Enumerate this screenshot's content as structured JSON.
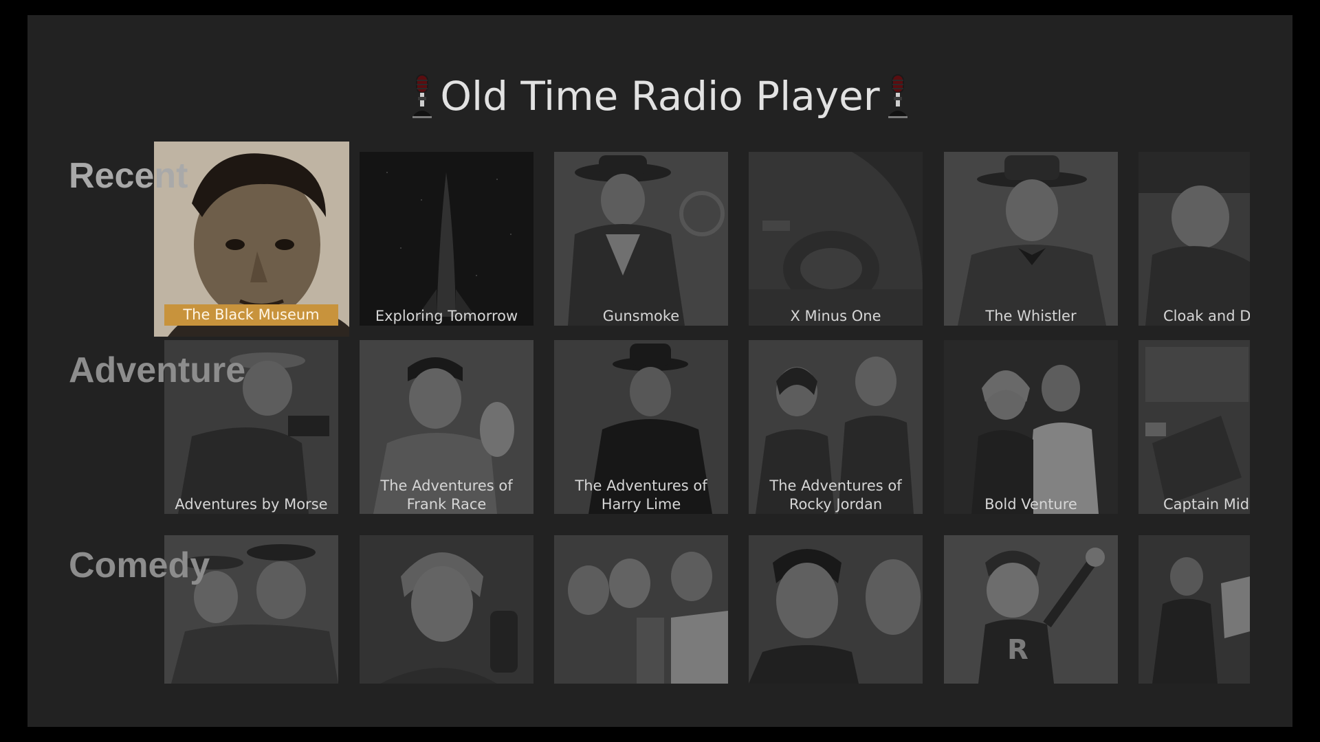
{
  "app": {
    "title": "Old Time Radio Player",
    "icon_left": "microphone-icon",
    "icon_right": "microphone-icon"
  },
  "colors": {
    "background": "#222222",
    "selected_label": "#c8933c",
    "row_title": "#8d8d8d"
  },
  "rows": [
    {
      "title": "Recent",
      "items": [
        {
          "label": "The Black Museum",
          "selected": true
        },
        {
          "label": "Exploring Tomorrow"
        },
        {
          "label": "Gunsmoke"
        },
        {
          "label": "X Minus One"
        },
        {
          "label": "The Whistler"
        },
        {
          "label": "Cloak and D"
        }
      ]
    },
    {
      "title": "Adventure",
      "items": [
        {
          "label": "Adventures by Morse"
        },
        {
          "label": "The Adventures of Frank Race"
        },
        {
          "label": "The Adventures of Harry Lime"
        },
        {
          "label": "The Adventures of Rocky Jordan"
        },
        {
          "label": "Bold Venture"
        },
        {
          "label": "Captain Mid"
        }
      ]
    },
    {
      "title": "Comedy",
      "items": [
        {
          "label": ""
        },
        {
          "label": ""
        },
        {
          "label": ""
        },
        {
          "label": ""
        },
        {
          "label": ""
        },
        {
          "label": ""
        }
      ]
    }
  ]
}
